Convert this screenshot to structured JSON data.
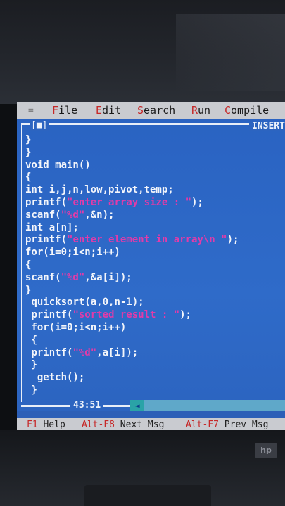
{
  "menu": {
    "system_icon": "≡",
    "items": [
      {
        "hot": "F",
        "rest": "ile"
      },
      {
        "hot": "E",
        "rest": "dit"
      },
      {
        "hot": "S",
        "rest": "earch"
      },
      {
        "hot": "R",
        "rest": "un"
      },
      {
        "hot": "C",
        "rest": "ompile"
      }
    ]
  },
  "editor": {
    "window_button": "[■]",
    "mode": "INSERT",
    "cursor_position": "43:51",
    "code_lines": [
      {
        "indent": "",
        "text": "}",
        "str": "",
        "tail": ""
      },
      {
        "indent": "",
        "text": "}",
        "str": "",
        "tail": ""
      },
      {
        "indent": "",
        "text": "void main()",
        "str": "",
        "tail": ""
      },
      {
        "indent": "",
        "text": "{",
        "str": "",
        "tail": ""
      },
      {
        "indent": "",
        "text": "int i,j,n,low,pivot,temp;",
        "str": "",
        "tail": ""
      },
      {
        "indent": "",
        "text": "printf(",
        "str": "\"enter array size : \"",
        "tail": ");"
      },
      {
        "indent": "",
        "text": "scanf(",
        "str": "\"%d\"",
        "tail": ",&n);"
      },
      {
        "indent": "",
        "text": "int a[n];",
        "str": "",
        "tail": ""
      },
      {
        "indent": "",
        "text": "printf(",
        "str": "\"enter element in array\\n \"",
        "tail": ");"
      },
      {
        "indent": "",
        "text": "for(i=0;i<n;i++)",
        "str": "",
        "tail": ""
      },
      {
        "indent": "",
        "text": "{",
        "str": "",
        "tail": ""
      },
      {
        "indent": "",
        "text": "scanf(",
        "str": "\"%d\"",
        "tail": ",&a[i]);"
      },
      {
        "indent": "",
        "text": "}",
        "str": "",
        "tail": ""
      },
      {
        "indent": " ",
        "text": "quicksort(a,0,n-1);",
        "str": "",
        "tail": ""
      },
      {
        "indent": " ",
        "text": "printf(",
        "str": "\"sorted result : \"",
        "tail": ");"
      },
      {
        "indent": " ",
        "text": "for(i=0;i<n;i++)",
        "str": "",
        "tail": ""
      },
      {
        "indent": " ",
        "text": "{",
        "str": "",
        "tail": ""
      },
      {
        "indent": " ",
        "text": "printf(",
        "str": "\"%d\"",
        "tail": ",a[i]);"
      },
      {
        "indent": " ",
        "text": "}",
        "str": "",
        "tail": ""
      },
      {
        "indent": "  ",
        "text": "getch();",
        "str": "",
        "tail": ""
      },
      {
        "indent": " ",
        "text": "}",
        "str": "",
        "tail": ""
      }
    ]
  },
  "statusbar": {
    "items": [
      {
        "key": "F1",
        "label": "Help"
      },
      {
        "key": "Alt-F8",
        "label": "Next Msg"
      },
      {
        "key": "Alt-F7",
        "label": "Prev Msg"
      }
    ]
  },
  "colors": {
    "editor_bg": "#2c64c0",
    "code_text": "#f4f6fb",
    "string_literal": "#e23ba9",
    "menu_bg": "#c9cbd0",
    "hotkey": "#c62828"
  }
}
